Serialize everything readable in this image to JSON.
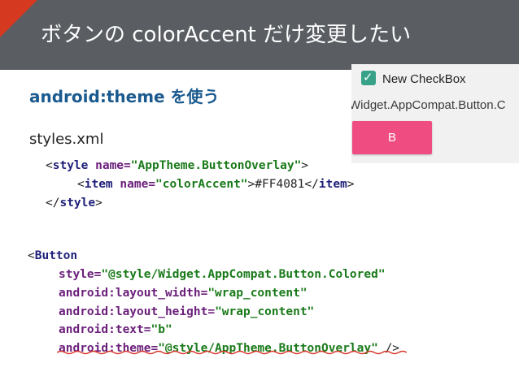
{
  "slide": {
    "title": "ボタンの colorAccent だけ変更したい",
    "subtitle": "android:theme を使う",
    "file_label": "styles.xml"
  },
  "preview": {
    "checkbox_label": "New CheckBox",
    "style_text": "Widget.AppCompat.Button.C",
    "button_label": "B",
    "button_color": "#EF4D82",
    "checkbox_color": "#37A287"
  },
  "styles_code": {
    "open_lt": "<",
    "style_tag": "style",
    "name_attr": " name=",
    "style_name": "\"AppTheme.ButtonOverlay\"",
    "open_gt": ">",
    "item_lt": "<",
    "item_tag": "item",
    "item_name_attr": " name=",
    "item_name": "\"colorAccent\"",
    "item_value": ">#FF4081</",
    "item_close_tag": "item",
    "item_gt": ">",
    "close_lt": "</",
    "close_tag": "style",
    "close_gt": ">"
  },
  "button_code": {
    "open": "<",
    "tag": "Button",
    "style_attr": "style=",
    "style_val": "\"@style/Widget.AppCompat.Button.Colored\"",
    "width_attr": "android:layout_width=",
    "width_val": "\"wrap_content\"",
    "height_attr": "android:layout_height=",
    "height_val": "\"wrap_content\"",
    "text_attr": "android:text=",
    "text_val": "\"b\"",
    "theme_attr": "android:theme=",
    "theme_val": "\"@style/AppTheme.ButtonOverlay\"",
    "end": " />"
  },
  "colors": {
    "header_bg": "#5A5E63",
    "accent_red": "#D53A21",
    "subtitle_blue": "#1A5A8E"
  }
}
